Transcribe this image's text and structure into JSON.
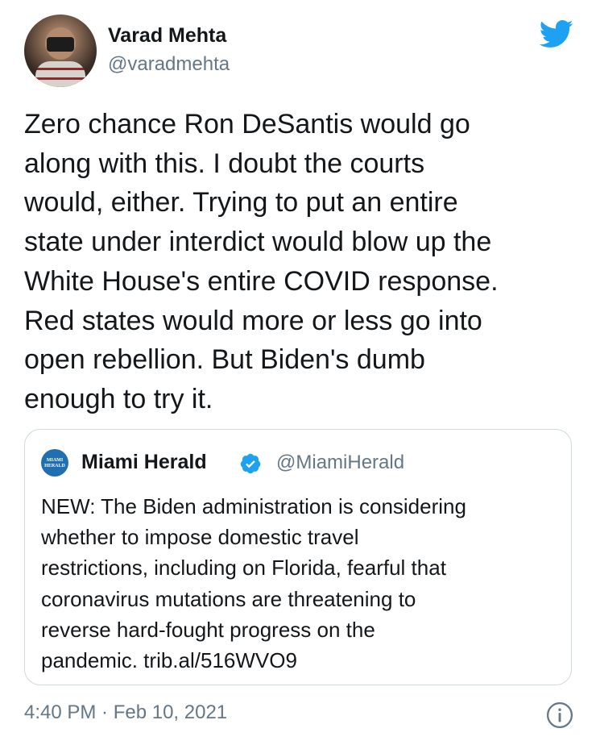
{
  "author": {
    "name": "Varad Mehta",
    "handle": "@varadmehta"
  },
  "tweet": {
    "lines": [
      "Zero chance Ron DeSantis would go",
      "along with this. I doubt the courts",
      "would, either. Trying to put an entire",
      "state under interdict would blow up the",
      "White House's entire COVID response.",
      "Red states would more or less go into",
      "open rebellion. But Biden's dumb",
      "enough to try it."
    ],
    "timestamp": "4:40 PM · Feb 10, 2021"
  },
  "quoted": {
    "logo_text": "MIAMI HERALD",
    "name": "Miami Herald",
    "handle": "@MiamiHerald",
    "verified": true,
    "lines": [
      "NEW: The Biden administration is considering",
      "whether to impose domestic travel",
      "restrictions, including on Florida, fearful that",
      "coronavirus mutations are threatening to",
      "reverse hard-fought progress on the",
      "pandemic. trib.al/516WVO9"
    ]
  },
  "icons": {
    "brand": "twitter-bird-icon",
    "verified": "verified-badge-icon",
    "info": "info-icon"
  },
  "colors": {
    "twitter_blue": "#1DA1F2",
    "secondary_text": "#657786",
    "border": "#CFD9DE",
    "herald_blue": "#1F6FB2"
  }
}
